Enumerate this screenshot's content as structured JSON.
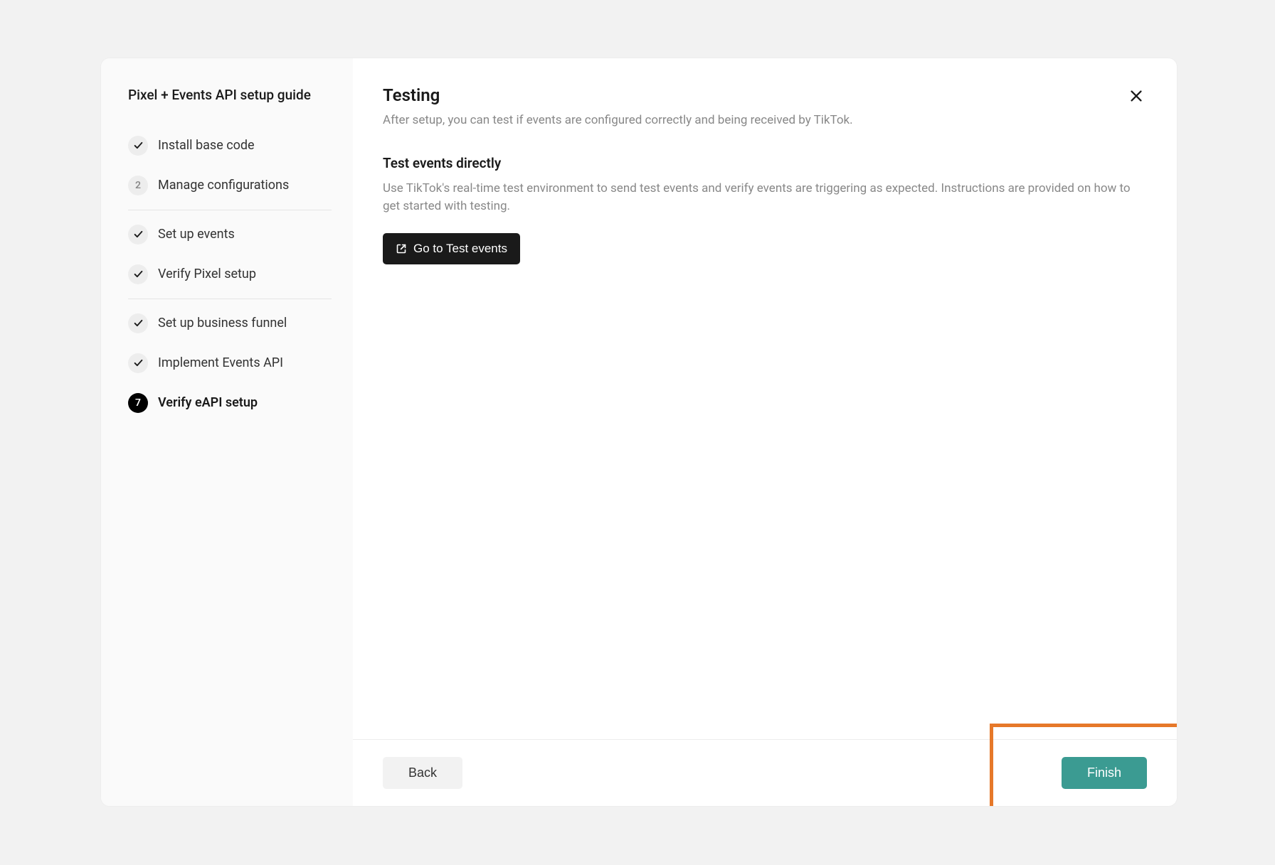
{
  "sidebar": {
    "title": "Pixel + Events API setup guide",
    "steps": [
      {
        "label": "Install base code",
        "state": "completed"
      },
      {
        "label": "Manage configurations",
        "state": "numbered",
        "number": "2"
      },
      {
        "label": "Set up events",
        "state": "completed"
      },
      {
        "label": "Verify Pixel setup",
        "state": "completed"
      },
      {
        "label": "Set up business funnel",
        "state": "completed"
      },
      {
        "label": "Implement Events API",
        "state": "completed"
      },
      {
        "label": "Verify eAPI setup",
        "state": "active",
        "number": "7"
      }
    ]
  },
  "main": {
    "title": "Testing",
    "subtitle": "After setup, you can test if events are configured correctly and being received by TikTok.",
    "section_title": "Test events directly",
    "section_desc": "Use TikTok's real-time test environment to send test events and verify events are triggering as expected. Instructions are provided on how to get started with testing.",
    "test_button": "Go to Test events"
  },
  "footer": {
    "back": "Back",
    "finish": "Finish"
  }
}
